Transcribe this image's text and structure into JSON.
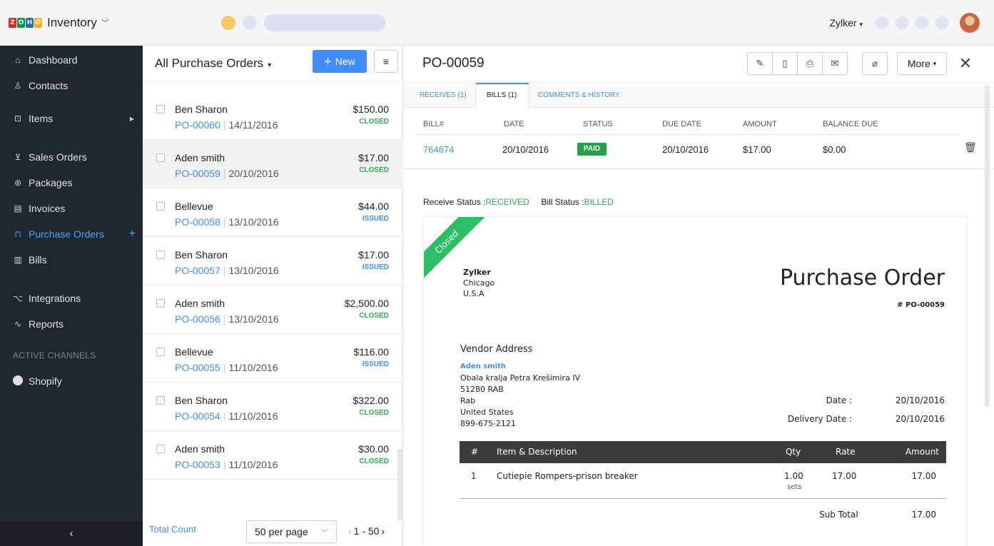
{
  "app": {
    "brand": "Inventory",
    "logo_letters": [
      "Z",
      "O",
      "H",
      "O"
    ],
    "logo_colors": [
      "#e42527",
      "#089949",
      "#226db4",
      "#f9b21d"
    ],
    "org_name": "Zylker"
  },
  "sidebar": {
    "items": [
      {
        "icon": "⌂",
        "label": "Dashboard"
      },
      {
        "icon": "♙",
        "label": "Contacts"
      },
      {
        "icon": "⊡",
        "label": "Items"
      },
      {
        "icon": "⊻",
        "label": "Sales Orders"
      },
      {
        "icon": "⊛",
        "label": "Packages"
      },
      {
        "icon": "▤",
        "label": "Invoices"
      },
      {
        "icon": "⊓",
        "label": "Purchase Orders"
      },
      {
        "icon": "▥",
        "label": "Bills"
      },
      {
        "icon": "⌥",
        "label": "Integrations"
      },
      {
        "icon": "∿",
        "label": "Reports"
      }
    ],
    "section_channels": "ACTIVE CHANNELS",
    "channel": "Shopify",
    "collapse_glyph": "‹"
  },
  "list": {
    "title": "All Purchase Orders",
    "new_label": "New",
    "rows": [
      {
        "vendor": "Ben Sharon",
        "po": "PO-00060",
        "date": "14/11/2016",
        "amount": "$150.00",
        "status": "CLOSED"
      },
      {
        "vendor": "Aden smith",
        "po": "PO-00059",
        "date": "20/10/2016",
        "amount": "$17.00",
        "status": "CLOSED"
      },
      {
        "vendor": "Bellevue",
        "po": "PO-00058",
        "date": "13/10/2016",
        "amount": "$44.00",
        "status": "ISSUED"
      },
      {
        "vendor": "Ben Sharon",
        "po": "PO-00057",
        "date": "13/10/2016",
        "amount": "$17.00",
        "status": "ISSUED"
      },
      {
        "vendor": "Aden smith",
        "po": "PO-00056",
        "date": "13/10/2016",
        "amount": "$2,500.00",
        "status": "CLOSED"
      },
      {
        "vendor": "Bellevue",
        "po": "PO-00055",
        "date": "11/10/2016",
        "amount": "$116.00",
        "status": "ISSUED"
      },
      {
        "vendor": "Ben Sharon",
        "po": "PO-00054",
        "date": "11/10/2016",
        "amount": "$322.00",
        "status": "CLOSED"
      },
      {
        "vendor": "Aden smith",
        "po": "PO-00053",
        "date": "11/10/2016",
        "amount": "$30.00",
        "status": "CLOSED"
      }
    ],
    "total_count_label": "Total Count",
    "per_page": "50 per page",
    "pager": "1 - 50"
  },
  "detail": {
    "title": "PO-00059",
    "more_label": "More",
    "tabs": [
      "RECEIVES (1)",
      "BILLS (1)",
      "COMMENTS & HISTORY"
    ],
    "bills_headers": [
      "BILL#",
      "DATE",
      "STATUS",
      "DUE DATE",
      "AMOUNT",
      "BALANCE DUE"
    ],
    "bill": {
      "number": "764674",
      "date": "20/10/2016",
      "status": "PAID",
      "due_date": "20/10/2016",
      "amount": "$17.00",
      "balance_due": "$0.00"
    },
    "receive_status_label": "Receive Status :",
    "receive_status": "RECEIVED",
    "bill_status_label": "Bill Status :",
    "bill_status": "BILLED"
  },
  "document": {
    "ribbon": "Closed",
    "org_name": "Zylker",
    "org_city": "Chicago",
    "org_country": "U.S.A",
    "title": "Purchase Order",
    "number": "# PO-00059",
    "vendor_address_label": "Vendor Address",
    "vendor_name": "Aden smith",
    "vendor_lines": [
      "Obala kralja Petra Krešimira IV",
      "51280 RAB",
      "Rab",
      "United States",
      "899-675-2121"
    ],
    "date_label": "Date :",
    "date": "20/10/2016",
    "delivery_label": "Delivery Date :",
    "delivery_date": "20/10/2016",
    "table_headers": {
      "num": "#",
      "item": "Item & Description",
      "qty": "Qty",
      "rate": "Rate",
      "amount": "Amount"
    },
    "item": {
      "num": "1",
      "description": "Cutiepie Rompers-prison breaker",
      "qty": "1.00",
      "unit": "sets",
      "rate": "17.00",
      "amount": "17.00"
    },
    "subtotal_label": "Sub Total",
    "subtotal": "17.00"
  }
}
